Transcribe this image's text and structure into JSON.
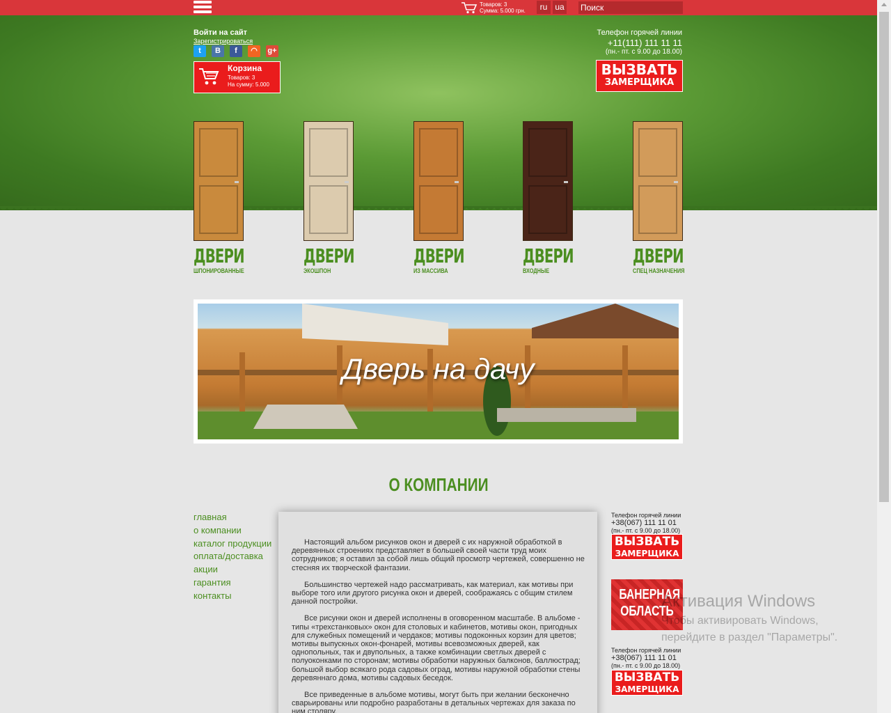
{
  "topbar": {
    "cart_items": "Товаров: 3",
    "cart_sum": "Сумма: 5.000 грн.",
    "lang_ru": "ru",
    "lang_ua": "ua",
    "search_placeholder": "Поиск"
  },
  "header": {
    "login": "Войти на сайт",
    "register": "Зарегистрироваться",
    "socials": [
      {
        "icon": "twitter-icon",
        "glyph": "t",
        "color": "#1da1f2"
      },
      {
        "icon": "vk-icon",
        "glyph": "В",
        "color": "#4a76a8"
      },
      {
        "icon": "facebook-icon",
        "glyph": "f",
        "color": "#3b5998"
      },
      {
        "icon": "rss-icon",
        "glyph": "◠",
        "color": "#f26522"
      },
      {
        "icon": "google-plus-icon",
        "glyph": "g+",
        "color": "#dd4b39"
      }
    ],
    "cart_box": {
      "title": "Корзина",
      "items": "Товаров: 3",
      "sum": "На сумму: 5.000"
    },
    "hotline_label": "Телефон горячей линии",
    "hotline_phone": "+11(111) 111 11 11",
    "hotline_hours": "(пн.- пт. с 9.00 до 18.00)",
    "call_button_a": "ВЫЗВАТЬ",
    "call_button_b": "ЗАМЕРЩИКА"
  },
  "doors": [
    {
      "big": "ДВЕРИ",
      "small": "шпонированные",
      "color": "#c98a3d"
    },
    {
      "big": "ДВЕРИ",
      "small": "экошпон",
      "color": "#dccbae"
    },
    {
      "big": "ДВЕРИ",
      "small": "из массива",
      "color": "#c47a34"
    },
    {
      "big": "ДВЕРИ",
      "small": "входные",
      "color": "#4a2418"
    },
    {
      "big": "ДВЕРИ",
      "small": "спец назначения",
      "color": "#d29b5a"
    }
  ],
  "banner": {
    "text": "Дверь на дачу"
  },
  "about": {
    "title": "О КОМПАНИИ",
    "nav": [
      "главная",
      "о компании",
      "каталог продукции",
      "оплата/доставка",
      "акции",
      "гарантия",
      "контакты"
    ],
    "paragraphs": [
      "Настоящий альбом рисунков окон и дверей с их наружной обработкой в деревянных строениях представляет в большей своей части труд моих сотрудников; я оставил за собой лишь общий просмотр чертежей, совершенно не стесняя их творческой фантазии.",
      "Большинство чертежей надо рассматривать, как материал, как мотивы при выборе того или другого рисунка окон и дверей, соображаясь с общим стилем данной постройки.",
      "Все рисунки окон и дверей исполнены в оговоренном масштабе. В альбоме - типы «трехстанковых» окон для столовых и кабинетов, мотивы окон, пригодных для служебных помещений и чердаков; мотивы подоконных корзин для цветов; мотивы выпускных окон-фонарей, мотивы всевозможных дверей, как однопольных, так и двупольных, а также комбинации светлых дверей с полуоконками по сторонам; мотивы обработки наружных балконов, баллюстрад; большой выбор всякаго рода садовых оград, мотивы наружной обработки стены деревяннаго дома, мотивы садовых беседок.",
      "Все приведенные в альбоме мотивы, могут быть при желании бесконечно сварьированы или подробно разработаны в детальных чертежах для заказа по ним столяру."
    ]
  },
  "sidebar_right": {
    "hotline_label": "Телефон горячей линии",
    "phone": "+38(067) 111 11 01",
    "hours": "(пн.- пт. с 9.00 до 18.00)",
    "call_a": "ВЫЗВАТЬ",
    "call_b": "ЗАМЕРЩИКА",
    "banner_line1": "БАНЕРНАЯ",
    "banner_line2": "ОБЛАСТЬ"
  },
  "watermark": {
    "line1": "Активация Windows",
    "line2": "Чтобы активировать Windows,",
    "line3": "перейдите в раздел \"Параметры\"."
  },
  "colors": {
    "accent_red": "#d9363a",
    "brand_green": "#4b8e20"
  }
}
